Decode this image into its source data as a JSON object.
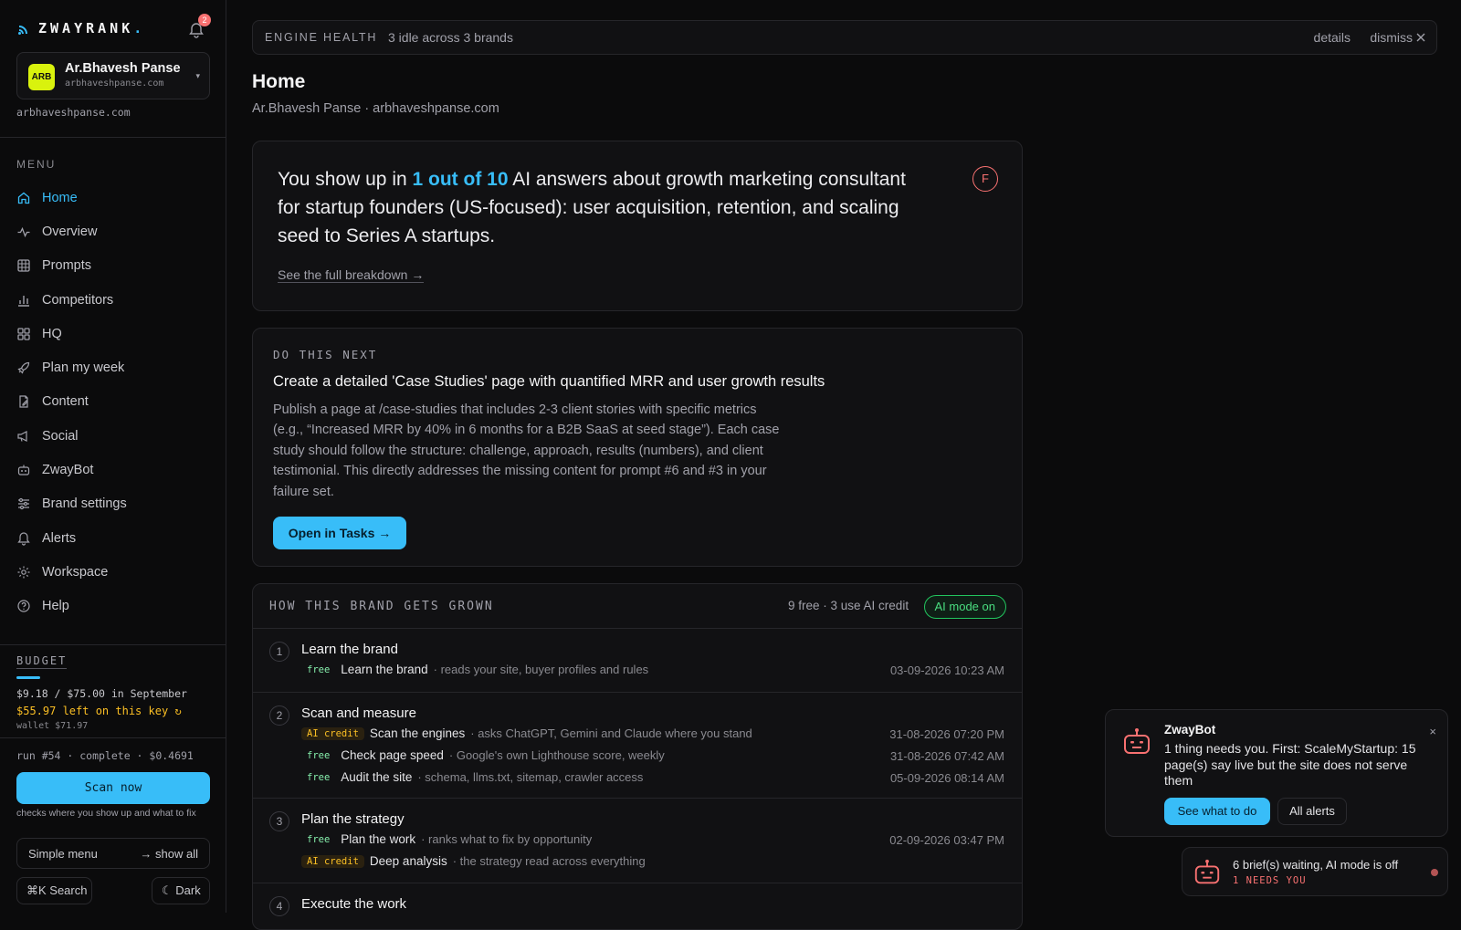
{
  "brand": {
    "name": "ZWAYRANK",
    "dot": "."
  },
  "notifications": {
    "count": "2"
  },
  "account": {
    "initials": "ARB",
    "name": "Ar.Bhavesh Panse",
    "domain": "arbhaveshpanse.com",
    "domain_below": "arbhaveshpanse.com"
  },
  "sidebar": {
    "menu_label": "MENU",
    "items": [
      {
        "label": "Home",
        "icon": "home-icon",
        "active": true
      },
      {
        "label": "Overview",
        "icon": "pulse-icon"
      },
      {
        "label": "Prompts",
        "icon": "grid-icon"
      },
      {
        "label": "Competitors",
        "icon": "bar-chart-icon"
      },
      {
        "label": "HQ",
        "icon": "squares-icon"
      },
      {
        "label": "Plan my week",
        "icon": "rocket-icon"
      },
      {
        "label": "Content",
        "icon": "document-edit-icon"
      },
      {
        "label": "Social",
        "icon": "megaphone-icon"
      },
      {
        "label": "ZwayBot",
        "icon": "robot-icon"
      },
      {
        "label": "Brand settings",
        "icon": "sliders-icon"
      },
      {
        "label": "Alerts",
        "icon": "bell-icon"
      },
      {
        "label": "Workspace",
        "icon": "gear-icon"
      },
      {
        "label": "Help",
        "icon": "help-icon"
      }
    ]
  },
  "budget": {
    "label": "BUDGET",
    "spent_line": "$9.18 / $75.00 in September",
    "left_line": "$55.97 left on this key",
    "wallet_line": "wallet $71.97",
    "run_line": "run #54 · complete · $0.4691",
    "scan_button": "Scan now",
    "scan_sub": "checks where you show up and what to fix",
    "progress_pct": 12
  },
  "footer": {
    "simple_menu": "Simple menu",
    "show_all": "→ show all",
    "search": "⌘K Search",
    "theme": "Dark"
  },
  "health": {
    "label": "ENGINE HEALTH",
    "text": "3 idle across 3 brands",
    "details": "details",
    "dismiss": "dismiss"
  },
  "page": {
    "title": "Home",
    "subtitle": "Ar.Bhavesh Panse · arbhaveshpanse.com"
  },
  "hero": {
    "prefix": "You show up in ",
    "highlight": "1 out of 10",
    "suffix": " AI answers about growth marketing consultant for startup founders (US-focused): user acquisition, retention, and scaling seed to Series A startups.",
    "link": "See the full breakdown →",
    "grade": "F"
  },
  "next": {
    "label": "DO THIS NEXT",
    "title": "Create a detailed 'Case Studies' page with quantified MRR and user growth results",
    "body": "Publish a page at /case-studies that includes 2-3 client stories with specific metrics (e.g., “Increased MRR by 40% in 6 months for a B2B SaaS at seed stage”). Each case study should follow the structure: challenge, approach, results (numbers), and client testimonial. This directly addresses the missing content for prompt #6 and #3 in your failure set.",
    "button": "Open in Tasks →"
  },
  "grow": {
    "label": "HOW THIS BRAND GETS GROWN",
    "meta": "9 free · 3 use AI credit",
    "ai_mode": "AI mode on",
    "steps": [
      {
        "num": "1",
        "title": "Learn the brand",
        "tasks": [
          {
            "tag": "free",
            "name": "Learn the brand",
            "desc": "· reads your site, buyer profiles and rules",
            "time": "03-09-2026 10:23 AM"
          }
        ]
      },
      {
        "num": "2",
        "title": "Scan and measure",
        "tasks": [
          {
            "tag": "AI credit",
            "name": "Scan the engines",
            "desc": "· asks ChatGPT, Gemini and Claude where you stand",
            "time": "31-08-2026 07:20 PM"
          },
          {
            "tag": "free",
            "name": "Check page speed",
            "desc": "· Google's own Lighthouse score, weekly",
            "time": "31-08-2026 07:42 AM"
          },
          {
            "tag": "free",
            "name": "Audit the site",
            "desc": "· schema, llms.txt, sitemap, crawler access",
            "time": "05-09-2026 08:14 AM"
          }
        ]
      },
      {
        "num": "3",
        "title": "Plan the strategy",
        "tasks": [
          {
            "tag": "free",
            "name": "Plan the work",
            "desc": "· ranks what to fix by opportunity",
            "time": "02-09-2026 03:47 PM"
          },
          {
            "tag": "AI credit",
            "name": "Deep analysis",
            "desc": "· the strategy read across everything",
            "time": ""
          }
        ]
      },
      {
        "num": "4",
        "title": "Execute the work",
        "tasks": []
      }
    ]
  },
  "toast": {
    "title": "ZwayBot",
    "body": "1 thing needs you. First: ScaleMyStartup: 15 page(s) say live but the site does not serve them",
    "primary": "See what to do",
    "secondary": "All alerts",
    "close": "×"
  },
  "mini": {
    "text": "6 brief(s) waiting, AI mode is off",
    "sub": "1 NEEDS YOU"
  }
}
